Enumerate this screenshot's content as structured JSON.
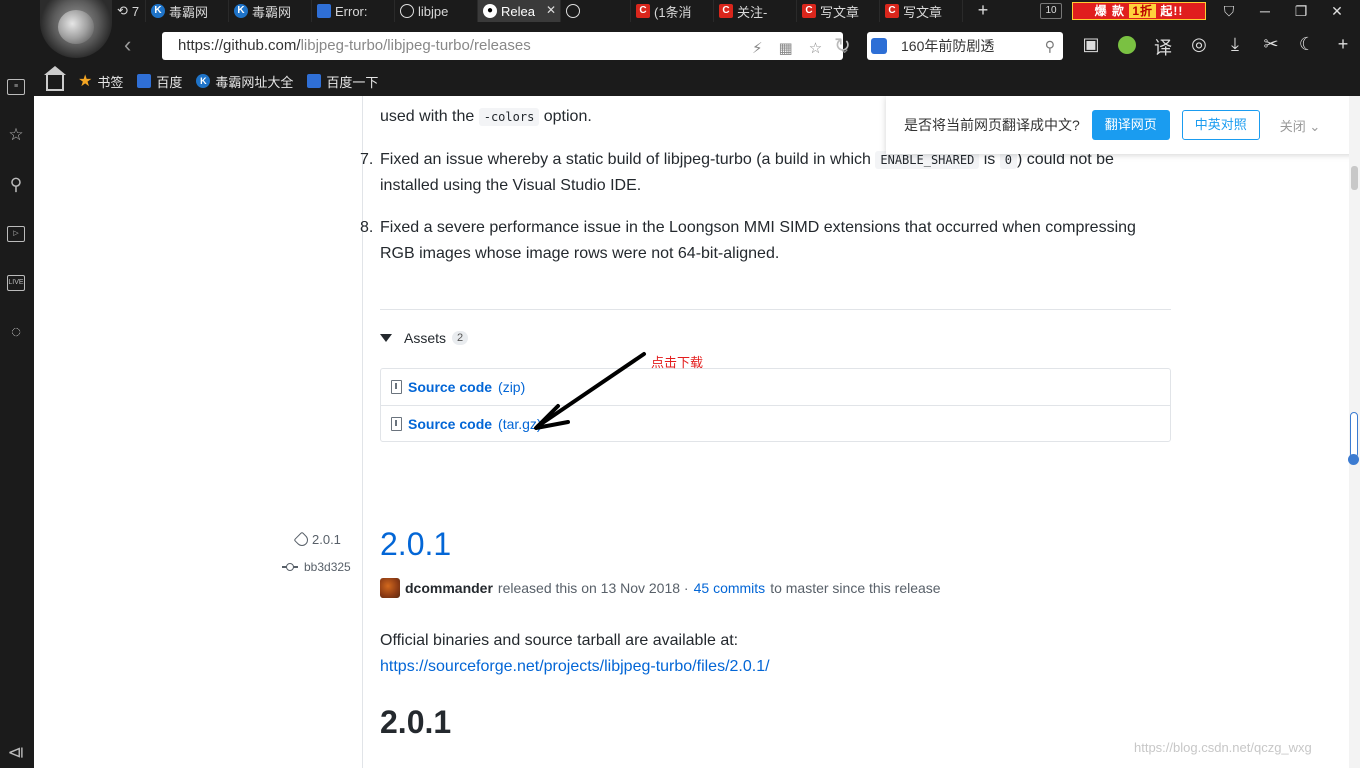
{
  "browser": {
    "tabs": [
      {
        "label": "7",
        "icon": "refresh-icon"
      },
      {
        "label": "毒霸网",
        "icon": "k-icon"
      },
      {
        "label": "毒霸网",
        "icon": "k-icon"
      },
      {
        "label": "Error:",
        "icon": "error-page-icon"
      },
      {
        "label": "libjpe",
        "icon": "globe-icon"
      },
      {
        "label": "Relea",
        "icon": "github-icon",
        "active": true
      },
      {
        "label": "",
        "icon": "globe-icon"
      },
      {
        "label": "(1条消",
        "icon": "csdn-icon"
      },
      {
        "label": "关注-",
        "icon": "csdn-icon"
      },
      {
        "label": "写文章",
        "icon": "csdn-icon"
      },
      {
        "label": "写文章",
        "icon": "csdn-icon"
      }
    ],
    "tab_count": "10",
    "promo": {
      "left": "爆 款",
      "mid": "1折",
      "right": "起!!"
    },
    "address": {
      "scheme_host": "https://github.com/",
      "path": "libjpeg-turbo/libjpeg-turbo/releases"
    },
    "search": {
      "value": "160年前防剧透"
    },
    "bookmarks": {
      "bookmarks_label": "书签",
      "items": [
        "百度",
        "毒霸网址大全",
        "百度一下"
      ]
    }
  },
  "translate_bar": {
    "question": "是否将当前网页翻译成中文?",
    "translate": "翻译网页",
    "bilingual": "中英对照",
    "close": "关闭"
  },
  "release_notes": {
    "item6_tail_a": "used with the ",
    "item6_code": "-colors",
    "item6_tail_b": " option.",
    "item7_num": "7.",
    "item7_a": "Fixed an issue whereby a static build of libjpeg-turbo (a build in which ",
    "item7_code1": "ENABLE_SHARED",
    "item7_b": " is ",
    "item7_code2": "0",
    "item7_c": ") could not be",
    "item7_d": "installed using the Visual Studio IDE.",
    "item8_num": "8.",
    "item8_a": "Fixed a severe performance issue in the Loongson MMI SIMD extensions that occurred when compressing",
    "item8_b": "RGB images whose image rows were not 64-bit-aligned."
  },
  "assets": {
    "label": "Assets",
    "count": "2",
    "items": [
      {
        "name": "Source code",
        "ext": "(zip)"
      },
      {
        "name": "Source code",
        "ext": "(tar.gz)"
      }
    ]
  },
  "annotation": "点击下载",
  "release": {
    "tag": "2.0.1",
    "commit": "bb3d325",
    "title": "2.0.1",
    "author": "dcommander",
    "released_text": "released this on 13 Nov 2018 ·",
    "commits_link": "45 commits",
    "commits_tail": "to master since this release",
    "body_text": "Official binaries and source tarball are available at:",
    "body_link": "https://sourceforge.net/projects/libjpeg-turbo/files/2.0.1/",
    "subheading": "2.0.1"
  },
  "watermark": "https://blog.csdn.net/qczg_wxg",
  "colors": {
    "link": "#0366d6",
    "annotation": "#e31d1d",
    "translate_button": "#1a9cf0"
  }
}
